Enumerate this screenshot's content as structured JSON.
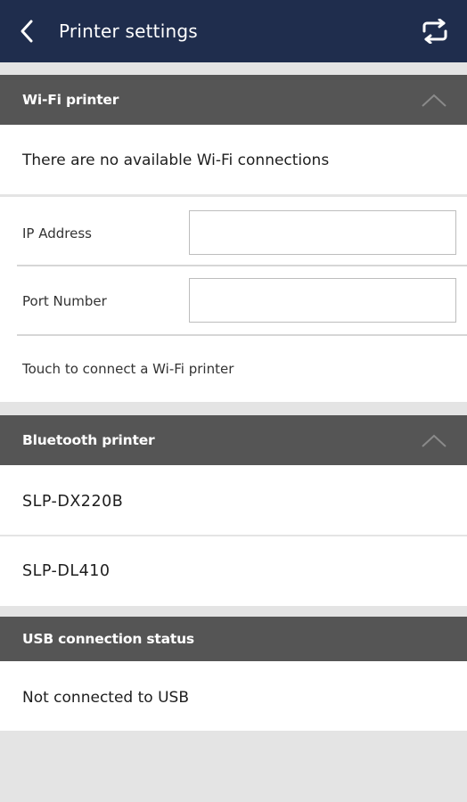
{
  "header": {
    "title": "Printer settings",
    "back_icon": "chevron-left-icon",
    "refresh_icon": "repeat-icon"
  },
  "wifi": {
    "section_title": "Wi-Fi printer",
    "no_connections": "There are no available Wi-Fi connections",
    "ip_label": "IP Address",
    "ip_value": "",
    "port_label": "Port Number",
    "port_value": "",
    "connect_text": "Touch to connect a Wi-Fi printer"
  },
  "bluetooth": {
    "section_title": "Bluetooth printer",
    "devices": [
      "SLP-DX220B",
      "SLP-DL410"
    ]
  },
  "usb": {
    "section_title": "USB connection status",
    "status": "Not connected to USB"
  },
  "colors": {
    "topbar": "#1f2d4d",
    "section_header": "#555555",
    "page_background": "#e4e4e4"
  }
}
